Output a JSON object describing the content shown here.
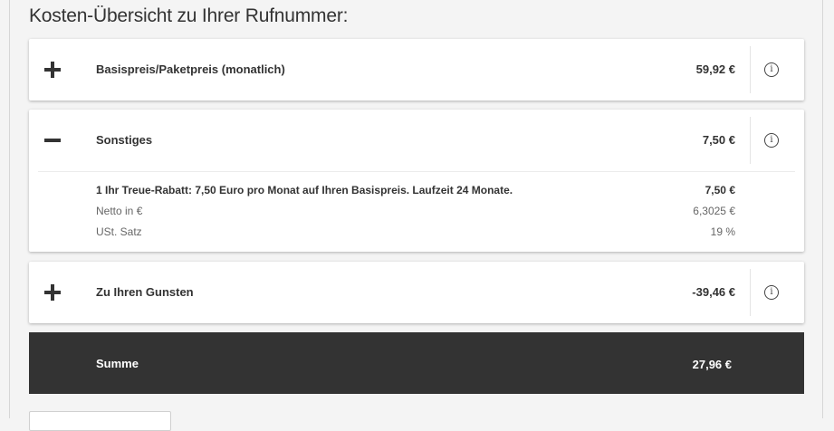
{
  "title": "Kosten-Übersicht zu Ihrer Rufnummer:",
  "rows": [
    {
      "toggle_state": "expand",
      "toggle_icon": "plus-icon",
      "label": "Basispreis/Paketpreis (monatlich)",
      "amount": "59,92 €"
    },
    {
      "toggle_state": "collapse",
      "toggle_icon": "minus-icon",
      "label": "Sonstiges",
      "amount": "7,50 €",
      "details": [
        {
          "text": "1 Ihr Treue-Rabatt: 7,50 Euro pro Monat auf Ihren Basispreis. Laufzeit 24 Monate.",
          "value": "7,50 €"
        },
        {
          "text": "Netto in €",
          "value": "6,3025 €"
        },
        {
          "text": "USt. Satz",
          "value": "19 %"
        }
      ]
    },
    {
      "toggle_state": "expand",
      "toggle_icon": "plus-icon",
      "label": "Zu Ihren Gunsten",
      "amount": "-39,46 €"
    }
  ],
  "info_glyph": "i",
  "summary": {
    "label": "Summe",
    "amount": "27,96 €"
  },
  "colors": {
    "summary_bg": "#333333",
    "card_bg": "#ffffff",
    "page_bg": "#f4f4f4"
  }
}
